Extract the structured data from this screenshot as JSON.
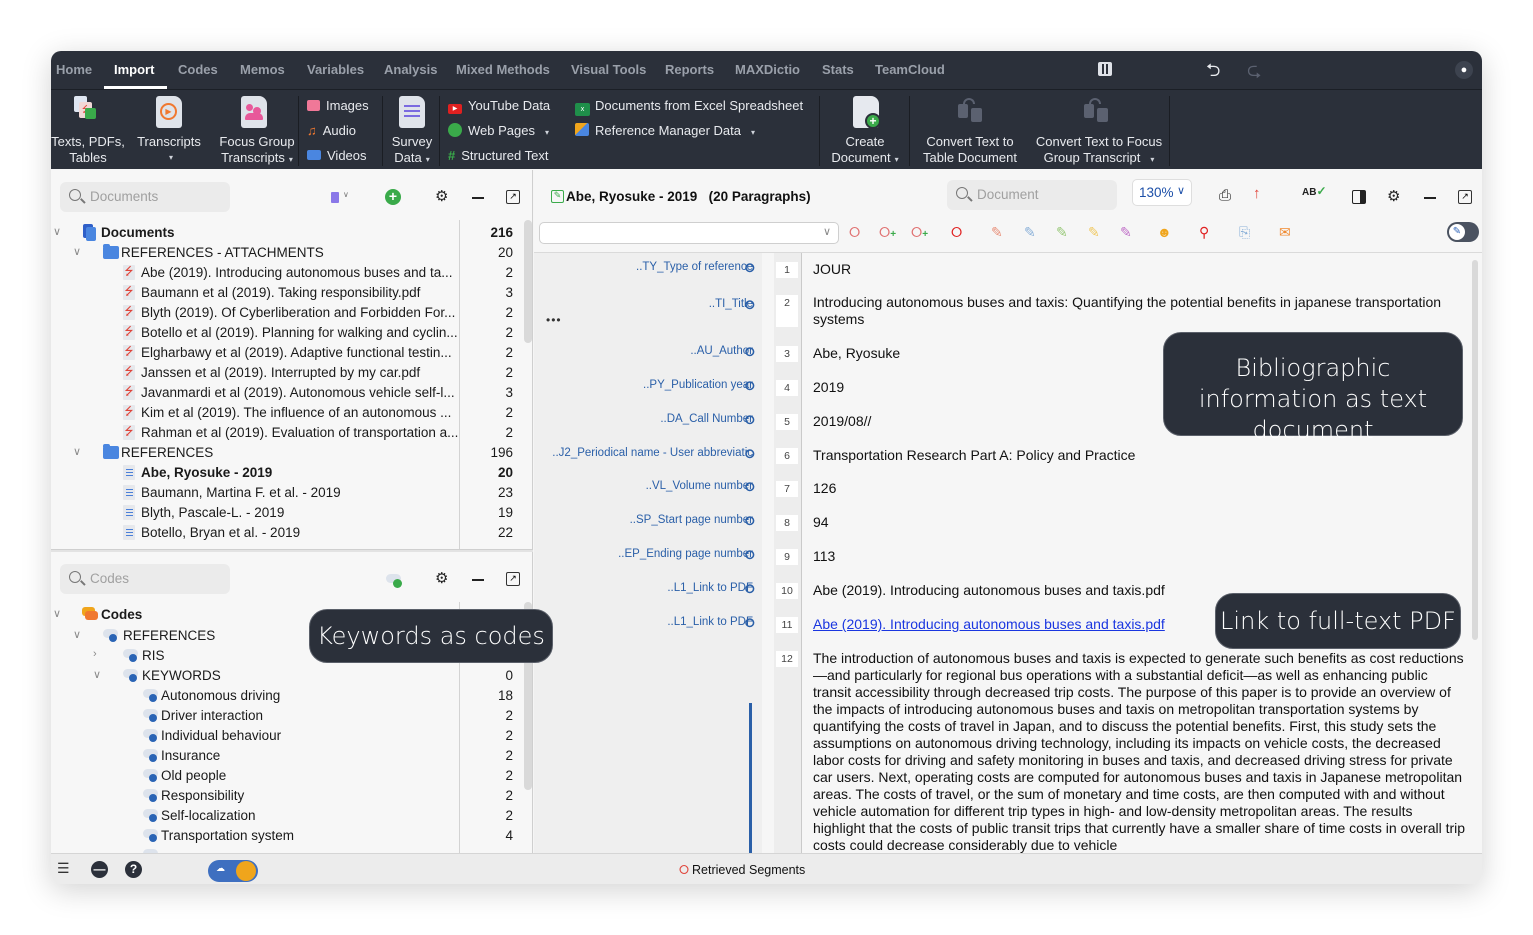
{
  "menu": {
    "tabs": [
      "Home",
      "Import",
      "Codes",
      "Memos",
      "Variables",
      "Analysis",
      "Mixed Methods",
      "Visual Tools",
      "Reports",
      "MAXDictio",
      "Stats",
      "TeamCloud"
    ],
    "active": "Import",
    "icons": {
      "layout": "layout-columns-icon",
      "undo": "undo-icon",
      "redo": "redo-icon",
      "user": "user-icon"
    }
  },
  "ribbon": {
    "texts_pdfs": {
      "line1": "Texts, PDFs,",
      "line2": "Tables"
    },
    "transcripts": {
      "line1": "Transcripts"
    },
    "focus_group": {
      "line1": "Focus Group",
      "line2": "Transcripts"
    },
    "images": "Images",
    "audio": "Audio",
    "videos": "Videos",
    "survey": {
      "line1": "Survey",
      "line2": "Data"
    },
    "youtube": "YouTube Data",
    "web_pages": "Web Pages",
    "structured_text": "Structured Text",
    "excel": "Documents from Excel Spreadsheet",
    "reference_manager": "Reference Manager Data",
    "create_document": {
      "line1": "Create",
      "line2": "Document"
    },
    "convert_table": {
      "line1": "Convert Text to",
      "line2": "Table Document"
    },
    "convert_focus": {
      "line1": "Convert Text to Focus",
      "line2": "Group Transcript"
    }
  },
  "documents_pane": {
    "search_placeholder": "Documents",
    "root": {
      "label": "Documents",
      "count": "216"
    },
    "groups": [
      {
        "label": "REFERENCES - ATTACHMENTS",
        "count": "20",
        "items": [
          {
            "label": "Abe (2019). Introducing autonomous buses and ta...",
            "count": "2"
          },
          {
            "label": "Baumann et al (2019). Taking responsibility.pdf",
            "count": "3"
          },
          {
            "label": "Blyth (2019). Of Cyberliberation and Forbidden For...",
            "count": "2"
          },
          {
            "label": "Botello et al (2019). Planning for walking and cyclin...",
            "count": "2"
          },
          {
            "label": "Elgharbawy et al (2019). Adaptive functional testin...",
            "count": "2"
          },
          {
            "label": "Janssen et al (2019). Interrupted by my car.pdf",
            "count": "2"
          },
          {
            "label": "Javanmardi et al (2019). Autonomous vehicle self-l...",
            "count": "3"
          },
          {
            "label": "Kim et al (2019). The influence of an autonomous ...",
            "count": "2"
          },
          {
            "label": "Rahman et al (2019). Evaluation of transportation a...",
            "count": "2"
          }
        ]
      },
      {
        "label": "REFERENCES",
        "count": "196",
        "items": [
          {
            "label": "Abe, Ryosuke - 2019",
            "count": "20",
            "bold": true
          },
          {
            "label": "Baumann, Martina F. et al. - 2019",
            "count": "23"
          },
          {
            "label": "Blyth, Pascale-L. - 2019",
            "count": "19"
          },
          {
            "label": "Botello, Bryan et al. - 2019",
            "count": "22"
          }
        ]
      }
    ]
  },
  "codes_pane": {
    "search_placeholder": "Codes",
    "root": {
      "label": "Codes"
    },
    "references": {
      "label": "REFERENCES"
    },
    "ris": {
      "label": "RIS"
    },
    "keywords": {
      "label": "KEYWORDS",
      "count": "0"
    },
    "keyword_items": [
      {
        "label": "Autonomous driving",
        "count": "18"
      },
      {
        "label": "Driver interaction",
        "count": "2"
      },
      {
        "label": "Individual behaviour",
        "count": "2"
      },
      {
        "label": "Insurance",
        "count": "2"
      },
      {
        "label": "Old people",
        "count": "2"
      },
      {
        "label": "Responsibility",
        "count": "2"
      },
      {
        "label": "Self-localization",
        "count": "2"
      },
      {
        "label": "Transportation system",
        "count": "4"
      }
    ]
  },
  "callouts": {
    "keywords": "Keywords as codes",
    "bibliographic": "Bibliographic information as text document",
    "link": "Link to full-text PDF"
  },
  "document_browser": {
    "title": "Abe, Ryosuke - 2019",
    "paragraphs_label": "(20 Paragraphs)",
    "search_placeholder": "Document",
    "zoom": "130%",
    "code_select_value": "",
    "paragraphs": [
      {
        "num": "1",
        "code": "..TY_Type of reference",
        "text": "JOUR"
      },
      {
        "num": "2",
        "code": "..TI_Title",
        "text": "Introducing autonomous buses and taxis: Quantifying the potential benefits in japanese transportation systems"
      },
      {
        "num": "3",
        "code": "..AU_Author",
        "text": "Abe, Ryosuke"
      },
      {
        "num": "4",
        "code": "..PY_Publication year",
        "text": "2019"
      },
      {
        "num": "5",
        "code": "..DA_Call Number",
        "text": "2019/08//"
      },
      {
        "num": "6",
        "code": "..J2_Periodical name - User abbreviatic",
        "text": "Transportation Research Part A: Policy and Practice"
      },
      {
        "num": "7",
        "code": "..VL_Volume number",
        "text": "126"
      },
      {
        "num": "8",
        "code": "..SP_Start page number",
        "text": "94"
      },
      {
        "num": "9",
        "code": "..EP_Ending page number",
        "text": "113"
      },
      {
        "num": "10",
        "code": "..L1_Link to PDF",
        "text": "Abe (2019). Introducing autonomous buses and taxis.pdf"
      },
      {
        "num": "11",
        "code": "..L1_Link to PDF",
        "text": "Abe (2019). Introducing autonomous buses and taxis.pdf",
        "link": true
      },
      {
        "num": "12",
        "code": "..AB_Abstract",
        "text": "The introduction of autonomous buses and taxis is expected to generate such benefits as cost reductions—and particularly for regional bus operations with a substantial deficit—as well as enhancing public transit accessibility through decreased trip costs. The purpose of this paper is to provide an overview of the impacts of introducing autonomous buses and taxis on metropolitan transportation systems by quantifying the costs of travel in Japan, and to discuss the potential benefits. First, this study sets the assumptions on autonomous driving technology, including its impacts on vehicle costs, the decreased labor costs for driving and safety monitoring in buses and taxis, and decreased driving stress for private car users. Next, operating costs are computed for autonomous buses and taxis in Japanese metropolitan areas. The costs of travel, or the sum of monetary and time costs, are then computed with and without vehicle automation for different trip types in high- and low-density metropolitan areas. The results highlight that the costs of public transit trips that currently have a smaller share of time costs in overall trip costs could decrease considerably due to vehicle"
      }
    ]
  },
  "statusbar": {
    "retrieved_segments": "Retrieved Segments"
  },
  "colors": {
    "dark_bg": "#2b303a",
    "code_blue": "#2a5fa8",
    "link_blue": "#1a36e0",
    "add_green": "#3aaa4a"
  }
}
